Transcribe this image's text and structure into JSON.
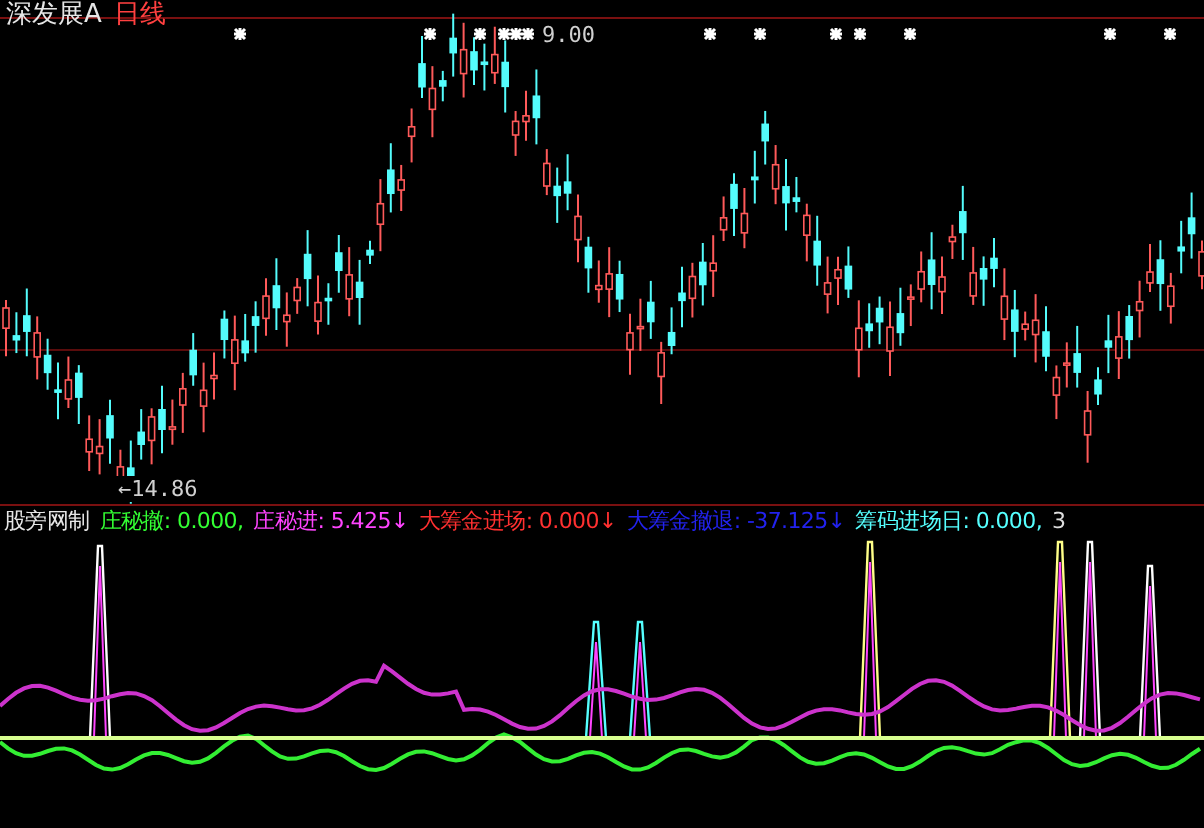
{
  "header": {
    "stock": "深发展A",
    "period": "日线"
  },
  "price_labels": [
    {
      "kind": "high",
      "text": "9.00"
    },
    {
      "kind": "low",
      "text": "←14.86"
    }
  ],
  "indicator": {
    "title": "股旁网制",
    "legend": [
      {
        "text": "庄秘撤: 0.000,",
        "color": "#33ff33"
      },
      {
        "text": "庄秘进: 5.425↓",
        "color": "#ff44ff"
      },
      {
        "text": "大筹金进场: 0.000↓",
        "color": "#ff3030"
      },
      {
        "text": "大筹金撤退: -37.125↓",
        "color": "#2222ee"
      },
      {
        "text": "筹码进场日: 0.000,",
        "color": "#55ffff"
      },
      {
        "text": "3",
        "color": "#dddddd"
      }
    ]
  }
}
